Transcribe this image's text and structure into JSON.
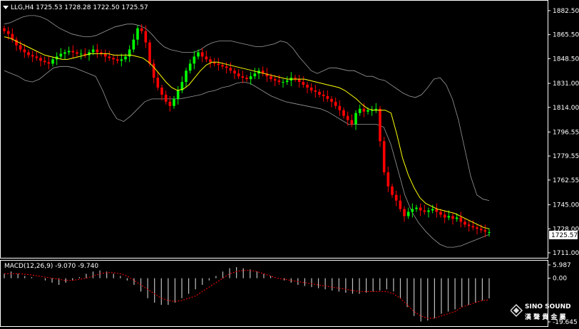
{
  "header": {
    "arrow_icon": "triangle-down-icon",
    "symbol_line": "LLG,H4  1725.53 1728.28 1722.50 1725.57"
  },
  "price_axis": {
    "ticks": [
      "1882.50",
      "1865.50",
      "1848.50",
      "1831.00",
      "1814.00",
      "1796.55",
      "1779.55",
      "1762.55",
      "1745.00",
      "1728.00",
      "1711.00"
    ],
    "current_price_label": "1725.57"
  },
  "macd": {
    "label": "MACD(12,26,9) -9.070 -9.740",
    "ticks": [
      "5.987",
      "0.00",
      "-19.645"
    ]
  },
  "watermark": {
    "brand": "SINO SOUND",
    "cjk": "漢 聲 貴 金 屬"
  },
  "colors": {
    "background": "#000000",
    "bull_candle": "#00ff00",
    "bear_candle": "#ff0000",
    "bollinger": "#c0c0c0",
    "moving_average": "#ffff00",
    "macd_hist": "#c0c0c0",
    "macd_signal": "#ff0000",
    "axis": "#ffffff"
  },
  "chart_data": {
    "type": "candlestick",
    "symbol": "LLG",
    "timeframe": "H4",
    "last_bar": {
      "open": 1725.53,
      "high": 1728.28,
      "low": 1722.5,
      "close": 1725.57
    },
    "ylim": [
      1711.0,
      1885.0
    ],
    "close": [
      1868,
      1866,
      1862,
      1858,
      1855,
      1853,
      1851,
      1850,
      1849,
      1847,
      1846,
      1845,
      1848,
      1850,
      1852,
      1853,
      1854,
      1853,
      1852,
      1852,
      1851,
      1853,
      1855,
      1853,
      1852,
      1850,
      1849,
      1848,
      1847,
      1848,
      1850,
      1855,
      1862,
      1870,
      1868,
      1860,
      1845,
      1835,
      1828,
      1823,
      1818,
      1815,
      1820,
      1826,
      1832,
      1840,
      1845,
      1850,
      1853,
      1850,
      1848,
      1846,
      1845,
      1844,
      1843,
      1842,
      1840,
      1838,
      1836,
      1835,
      1834,
      1836,
      1838,
      1840,
      1838,
      1836,
      1834,
      1833,
      1832,
      1832,
      1833,
      1835,
      1834,
      1832,
      1830,
      1828,
      1826,
      1825,
      1823,
      1822,
      1820,
      1818,
      1815,
      1812,
      1808,
      1805,
      1802,
      1810,
      1813,
      1811,
      1812,
      1812,
      1813,
      1790,
      1768,
      1758,
      1752,
      1748,
      1742,
      1737,
      1740,
      1742,
      1743,
      1741,
      1740,
      1741,
      1742,
      1740,
      1738,
      1736,
      1737,
      1735,
      1736,
      1733,
      1731,
      1730,
      1729,
      1728,
      1727,
      1726,
      1725.57
    ],
    "bollinger_upper": [
      1873,
      1874,
      1876,
      1878,
      1879,
      1879,
      1878,
      1876,
      1873,
      1870,
      1868,
      1866,
      1865,
      1864,
      1864,
      1865,
      1867,
      1869,
      1871,
      1872,
      1873,
      1873,
      1872,
      1870,
      1866,
      1861,
      1857,
      1855,
      1854,
      1853,
      1853,
      1853,
      1855,
      1858,
      1860,
      1861,
      1861,
      1861,
      1860,
      1859,
      1858,
      1857,
      1857,
      1858,
      1859,
      1861,
      1860,
      1856,
      1850,
      1845,
      1840,
      1838,
      1840,
      1842,
      1842,
      1841,
      1840,
      1840,
      1838,
      1836,
      1836,
      1834,
      1833,
      1830,
      1827,
      1824,
      1822,
      1821,
      1823,
      1828,
      1834,
      1835,
      1830,
      1820,
      1805,
      1785,
      1765,
      1752,
      1749,
      1748
    ],
    "bollinger_lower": [
      1840,
      1838,
      1836,
      1833,
      1832,
      1834,
      1838,
      1842,
      1843,
      1843,
      1842,
      1840,
      1838,
      1836,
      1826,
      1814,
      1806,
      1804,
      1808,
      1813,
      1818,
      1820,
      1820,
      1820,
      1820,
      1820,
      1821,
      1822,
      1823,
      1825,
      1826,
      1828,
      1829,
      1831,
      1832,
      1831,
      1828,
      1825,
      1822,
      1820,
      1818,
      1817,
      1816,
      1815,
      1814,
      1813,
      1811,
      1808,
      1805,
      1802,
      1802,
      1802,
      1802,
      1802,
      1800,
      1788,
      1770,
      1752,
      1740,
      1732,
      1726,
      1721,
      1717,
      1715,
      1715,
      1716,
      1718,
      1720,
      1722,
      1724
    ],
    "moving_average": [
      1864,
      1863,
      1861,
      1859,
      1857,
      1855,
      1853,
      1851,
      1850,
      1849,
      1848,
      1848,
      1849,
      1850,
      1851,
      1852,
      1852,
      1852,
      1852,
      1851,
      1851,
      1851,
      1851,
      1850,
      1849,
      1846,
      1842,
      1837,
      1832,
      1828,
      1826,
      1827,
      1830,
      1835,
      1840,
      1844,
      1846,
      1846,
      1845,
      1844,
      1843,
      1842,
      1841,
      1840,
      1839,
      1838,
      1837,
      1836,
      1835,
      1834,
      1834,
      1834,
      1834,
      1833,
      1832,
      1831,
      1830,
      1829,
      1828,
      1826,
      1823,
      1820,
      1816,
      1813,
      1812,
      1812,
      1812,
      1810,
      1795,
      1778,
      1766,
      1757,
      1750,
      1746,
      1744,
      1742,
      1741,
      1740,
      1739,
      1737,
      1735,
      1733,
      1731,
      1729,
      1728
    ],
    "macd_histogram": [
      2,
      3,
      2,
      1,
      0.5,
      0,
      -1,
      -2,
      -3,
      -2,
      -1,
      0.5,
      2,
      3,
      3.5,
      3,
      2,
      1,
      -1,
      -3,
      -6,
      -9,
      -11,
      -12,
      -12,
      -11,
      -9,
      -7,
      -5,
      -3,
      -1,
      1,
      3,
      4.5,
      5,
      4.5,
      4,
      3,
      2,
      1,
      0,
      -1,
      -2,
      -3,
      -3.5,
      -4,
      -4.5,
      -5,
      -5.5,
      -6,
      -6.5,
      -7,
      -7,
      -6.5,
      -6,
      -5.5,
      -5,
      -6,
      -9,
      -13,
      -17,
      -19.5,
      -19,
      -18,
      -16,
      -15,
      -14,
      -13,
      -12,
      -11,
      -10,
      -9.07
    ],
    "macd_signal": [
      2,
      2,
      2,
      1.8,
      1.5,
      1,
      0.5,
      0,
      -0.5,
      -1,
      -1,
      -0.5,
      0,
      1,
      2,
      2.5,
      2.5,
      2,
      1,
      -1,
      -3,
      -5,
      -7,
      -9,
      -10,
      -10.5,
      -10,
      -9,
      -8,
      -6,
      -4,
      -2,
      0,
      2,
      3,
      3.5,
      3.5,
      3,
      2,
      1,
      0,
      -0.5,
      -1,
      -1.5,
      -2,
      -2.5,
      -3,
      -3.5,
      -4,
      -4.5,
      -5,
      -5.5,
      -6,
      -6,
      -6,
      -6,
      -6,
      -7,
      -9,
      -12,
      -15,
      -17,
      -18,
      -18,
      -17,
      -16,
      -15,
      -13,
      -12,
      -11,
      -10,
      -9.74
    ],
    "macd_params": "12,26,9",
    "macd_values": {
      "main": -9.07,
      "signal": -9.74
    },
    "macd_ylim": [
      -19.645,
      5.987
    ]
  }
}
